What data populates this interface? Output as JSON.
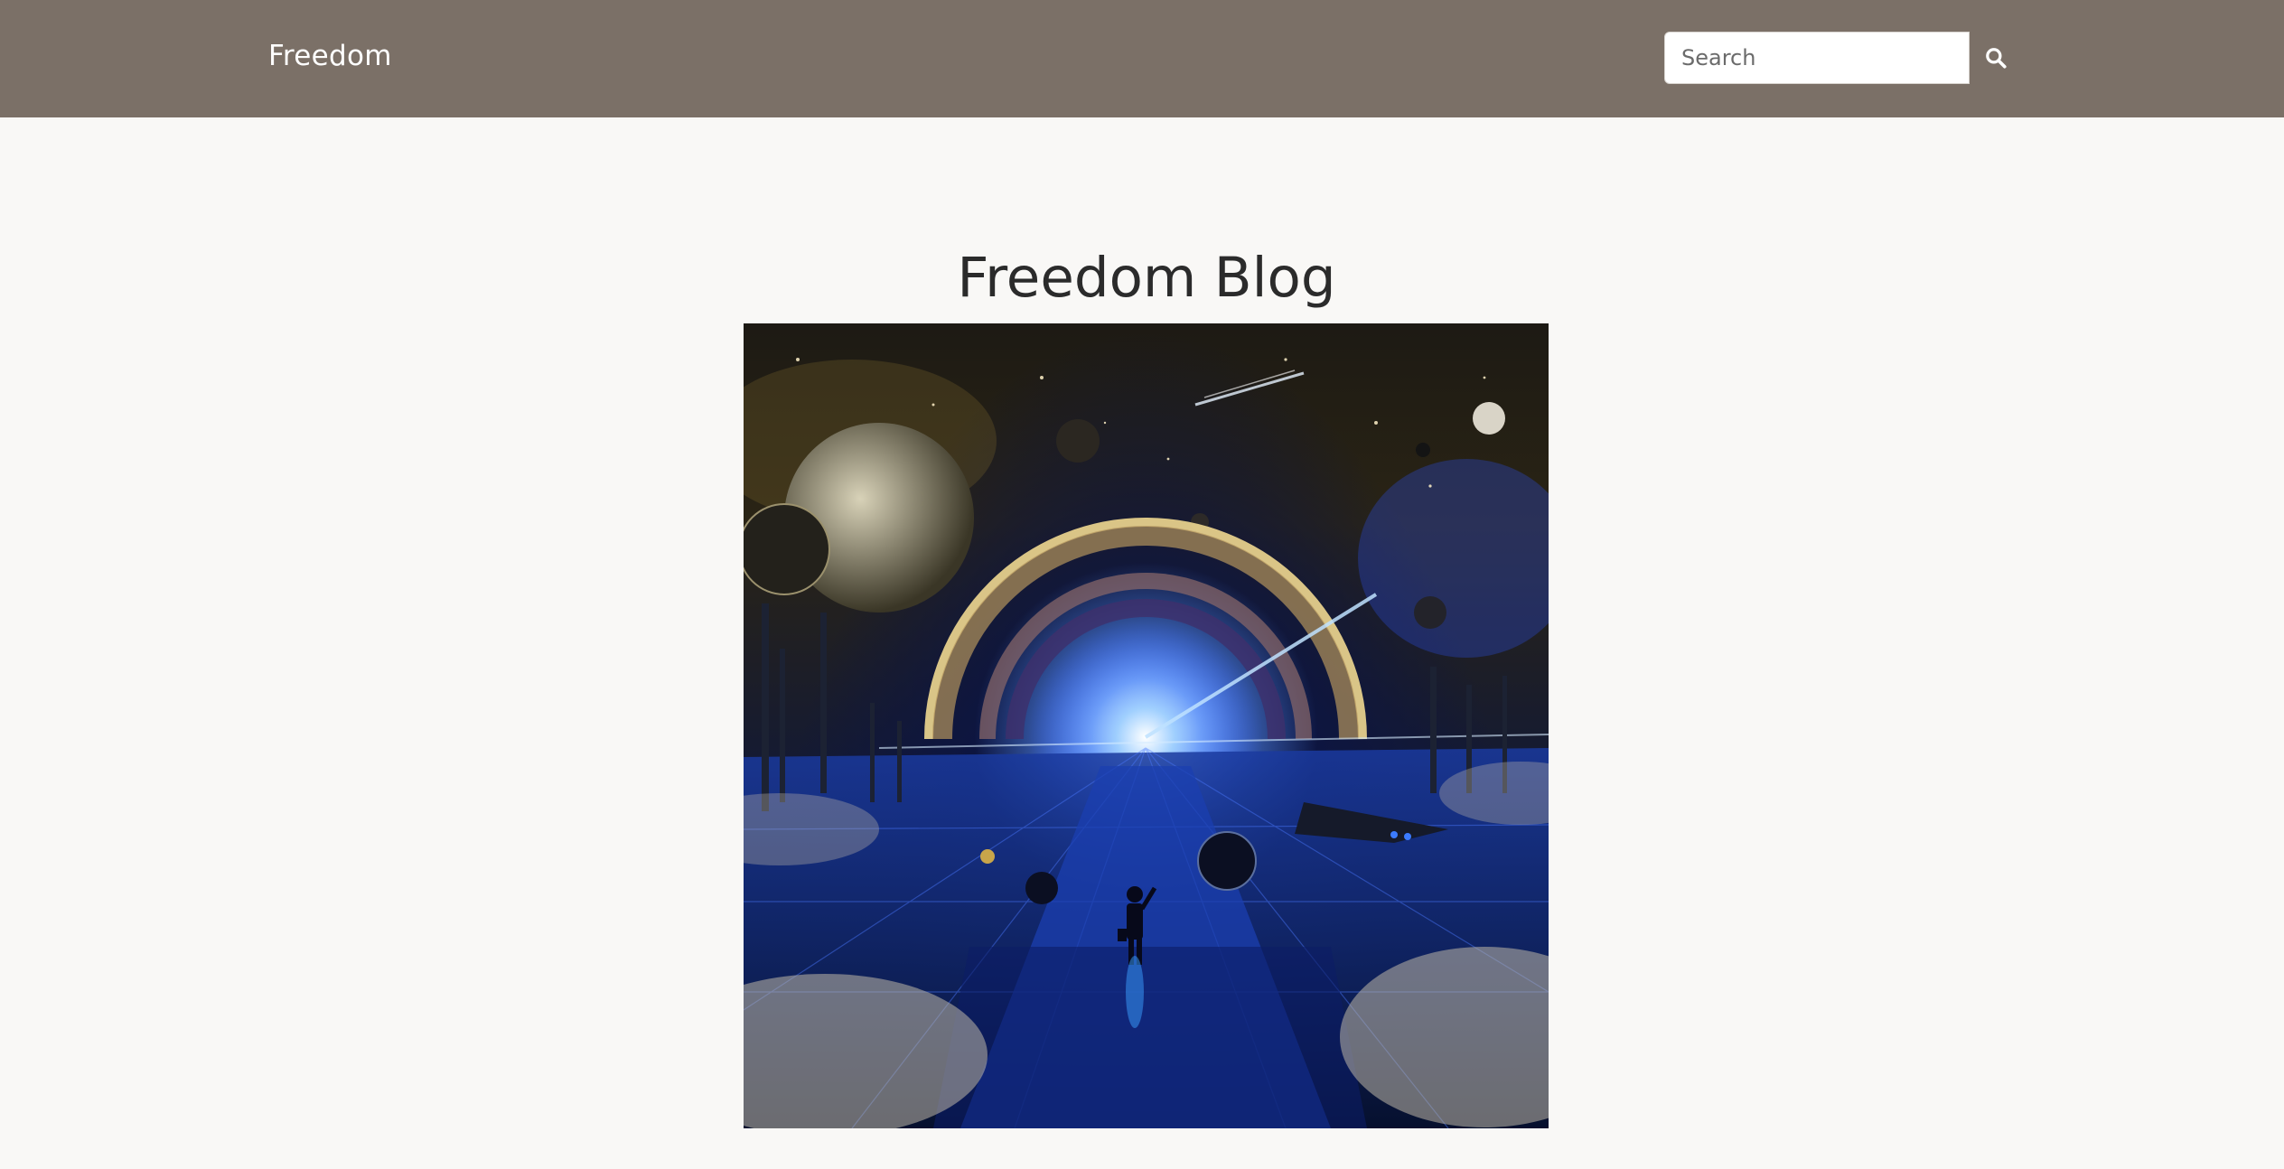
{
  "header": {
    "brand": "Freedom",
    "search": {
      "placeholder": "Search",
      "value": ""
    },
    "search_icon": "search-icon"
  },
  "main": {
    "title": "Freedom Blog",
    "hero_image_alt": "Sci-fi portal illustration"
  },
  "colors": {
    "navbar": "#7b7067",
    "page_background": "#f9f8f6"
  }
}
